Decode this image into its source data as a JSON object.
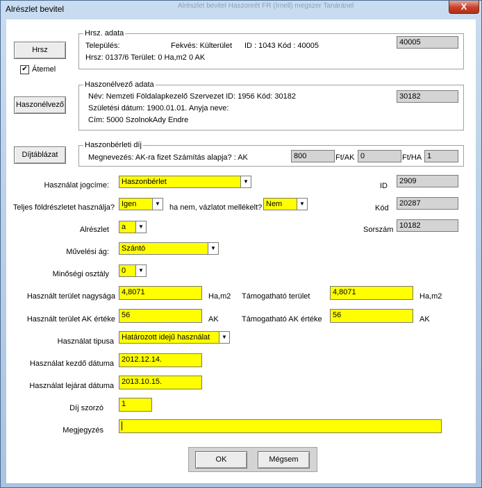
{
  "window": {
    "title": "Alrészlet bevitel",
    "ghost_text": "Alrészlet bevitel    Haszonrét   FR (Irnell)       megszer  Tanáránel",
    "close_symbol": "X"
  },
  "hrsz_group": {
    "button": "Hrsz",
    "atemel_label": "Átemel",
    "atemel_checked": true,
    "title": "Hrsz. adata",
    "telepules_label": "Település:",
    "telepules_value": "",
    "fekves": "Fekvés: Külterület",
    "id_kod": "ID : 1043  Kód : 40005",
    "hrsz_line": "Hrsz:  0137/6   Terület: 0 Ha,m2  0  AK",
    "code": "40005"
  },
  "haszonelvezo_group": {
    "button": "Haszonélvező",
    "title": "Haszonélvező adata",
    "nev": "Név:  Nemzeti Földalapkezelő Szervezet   ID: 1956   Kód: 30182",
    "szuletes": "Születési dátum: 1900.01.01.   Anyja neve:",
    "cim": "Cím: 5000 SzolnokAdy Endre",
    "code": "30182"
  },
  "dij_group": {
    "button": "Díjtáblázat",
    "title": "Haszonbérleti díj",
    "megnevezes": "Megnevezés: AK-ra fizet Számítás alapja? : AK",
    "val1": "800",
    "unit1": "Ft/AK",
    "val2": "0",
    "unit2": "Ft/HA",
    "val3": "1"
  },
  "form": {
    "hasznalat_jogcime_label": "Használat jogcíme:",
    "hasznalat_jogcime_value": "Haszonbérlet",
    "teljes_label": "Teljes földrészletet használja?",
    "teljes_value": "Igen",
    "vazlat_label": "ha nem, vázlatot mellékelt?",
    "vazlat_value": "Nem",
    "alreszlet_label": "Alrészlet",
    "alreszlet_value": "a",
    "muvelesi_label": "Művelési ág:",
    "muvelesi_value": "Szántó",
    "minosegi_label": "Minőségi osztály",
    "minosegi_value": "0",
    "terulet_label": "Használt terület nagysága",
    "terulet_value": "4,8071",
    "terulet_unit": "Ha,m2",
    "tam_terulet_label": "Támogatható terület",
    "tam_terulet_value": "4,8071",
    "tam_terulet_unit": "Ha,m2",
    "ak_label": "Használt terület AK értéke",
    "ak_value": "56",
    "ak_unit": "AK",
    "tam_ak_label": "Támogatható AK értéke",
    "tam_ak_value": "56",
    "tam_ak_unit": "AK",
    "tipusa_label": "Használat tipusa",
    "tipusa_value": "Határozott idejű használat",
    "kezdo_label": "Használat kezdő dátuma",
    "kezdo_value": "2012.12.14.",
    "lejarat_label": "Használat lejárat dátuma",
    "lejarat_value": "2013.10.15.",
    "dij_szorzo_label": "Díj szorzó",
    "dij_szorzo_value": "1",
    "megjegyzes_label": "Megjegyzés",
    "megjegyzes_value": ""
  },
  "right_fields": {
    "id_label": "ID",
    "id_value": "2909",
    "kod_label": "Kód",
    "kod_value": "20287",
    "sorszam_label": "Sorszám",
    "sorszam_value": "10182"
  },
  "buttons": {
    "ok": "OK",
    "cancel": "Mégsem"
  }
}
